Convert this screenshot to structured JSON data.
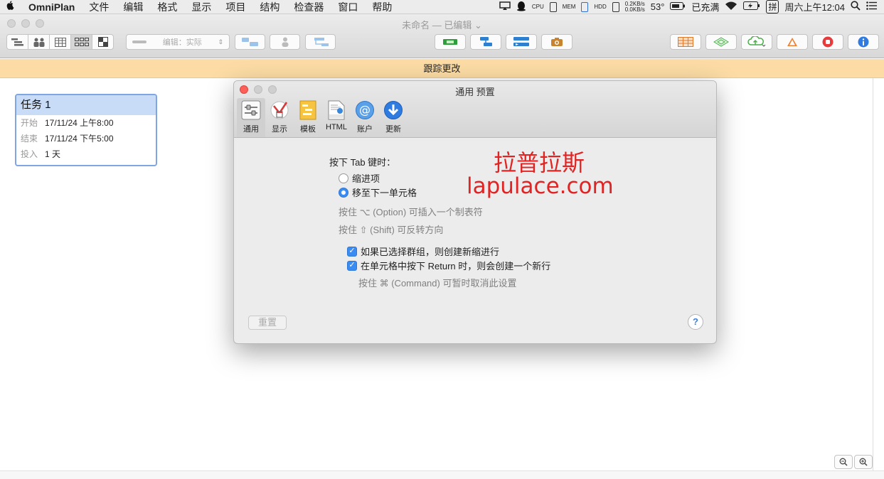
{
  "menubar": {
    "apple": "",
    "app_name": "OmniPlan",
    "items": [
      "文件",
      "编辑",
      "格式",
      "显示",
      "项目",
      "结构",
      "检查器",
      "窗口",
      "帮助"
    ],
    "status": {
      "cpu_label": "CPU",
      "mem_label": "MEM",
      "hdd_label": "HDD",
      "net_up": "0.2KB/s",
      "net_down": "0.0KB/s",
      "temp": "53°",
      "battery_label": "已充满",
      "input_method": "拼",
      "clock": "周六上午12:04"
    }
  },
  "window": {
    "title": "未命名 — 已编辑",
    "toolbar": {
      "popup_label": "编辑：实际"
    },
    "track_changes_label": "跟踪更改"
  },
  "task_card": {
    "title": "任务 1",
    "rows": [
      {
        "key": "开始",
        "value": "17/11/24 上午8:00"
      },
      {
        "key": "结束",
        "value": "17/11/24 下午5:00"
      },
      {
        "key": "投入",
        "value": "1 天"
      }
    ]
  },
  "dialog": {
    "title": "通用 预置",
    "tabs": [
      {
        "label": "通用",
        "icon": "sliders-icon"
      },
      {
        "label": "显示",
        "icon": "calendar-check-icon"
      },
      {
        "label": "模板",
        "icon": "template-icon"
      },
      {
        "label": "HTML",
        "icon": "html-document-icon"
      },
      {
        "label": "账户",
        "icon": "at-sign-icon"
      },
      {
        "label": "更新",
        "icon": "download-arrow-icon"
      }
    ],
    "tab_key_label": "按下 Tab 键时：",
    "radio_indent": "缩进项",
    "radio_next_cell": "移至下一单元格",
    "hint_option": "按住 ⌥ (Option) 可插入一个制表符",
    "hint_shift": "按住 ⇧ (Shift) 可反转方向",
    "check_group": "如果已选择群组，则创建新缩进行",
    "check_return": "在单元格中按下 Return 时，则会创建一个新行",
    "hint_command": "按住 ⌘ (Command) 可暂时取消此设置",
    "reset_label": "重置",
    "help_label": "?"
  },
  "watermark": {
    "line1": "拉普拉斯",
    "line2": "lapulace.com"
  },
  "zoom": {
    "zoom_out": "−",
    "zoom_in": "+"
  }
}
